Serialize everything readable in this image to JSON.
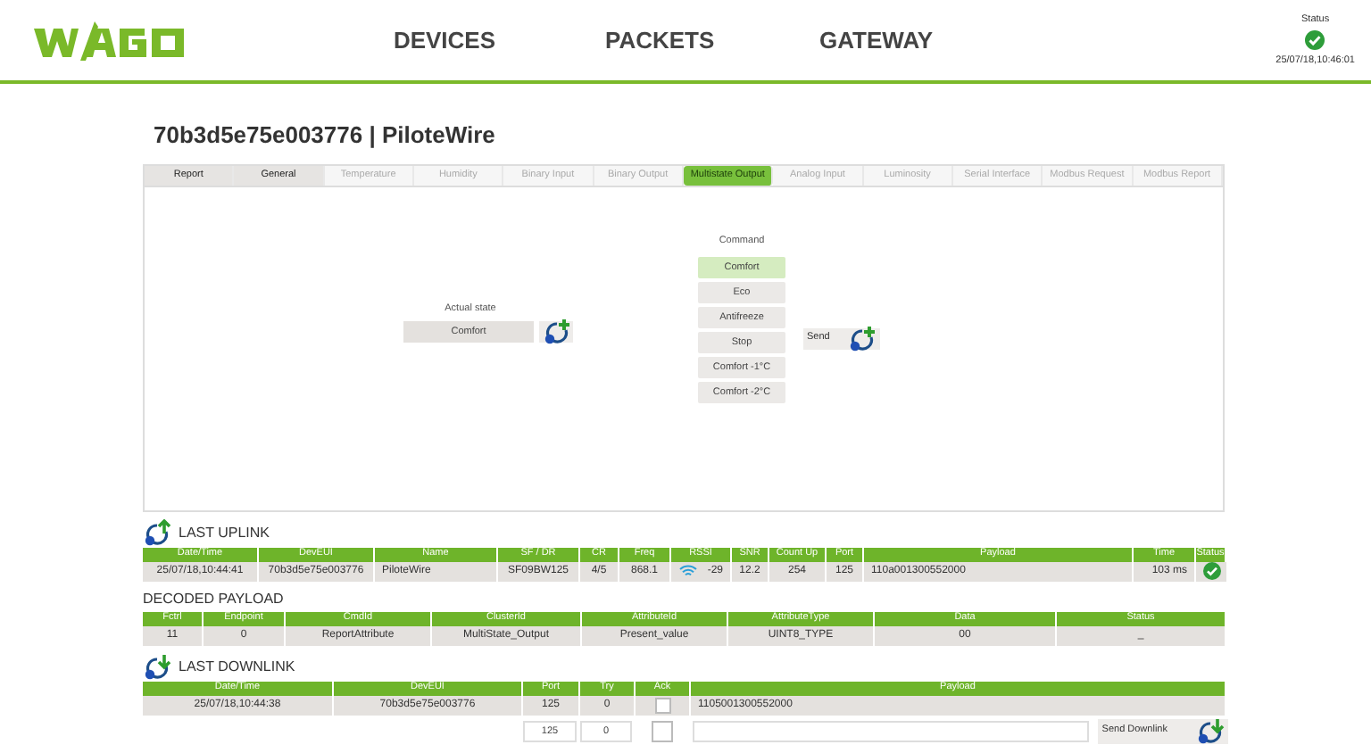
{
  "header": {
    "nav": [
      {
        "label": "DEVICES"
      },
      {
        "label": "PACKETS"
      },
      {
        "label": "GATEWAY"
      }
    ],
    "status": {
      "label": "Status",
      "ok": true,
      "time": "25/07/18,10:46:01"
    }
  },
  "title": "70b3d5e75e003776 | PiloteWire",
  "tabs": [
    {
      "label": "Report",
      "selected": false,
      "disabled": false
    },
    {
      "label": "General",
      "selected": false,
      "disabled": false
    },
    {
      "label": "Temperature",
      "selected": false,
      "disabled": true
    },
    {
      "label": "Humidity",
      "selected": false,
      "disabled": true
    },
    {
      "label": "Binary Input",
      "selected": false,
      "disabled": true
    },
    {
      "label": "Binary Output",
      "selected": false,
      "disabled": true
    },
    {
      "label": "Multistate Output",
      "selected": true,
      "disabled": false
    },
    {
      "label": "Analog Input",
      "selected": false,
      "disabled": true
    },
    {
      "label": "Luminosity",
      "selected": false,
      "disabled": true
    },
    {
      "label": "Serial Interface",
      "selected": false,
      "disabled": true
    },
    {
      "label": "Modbus Request",
      "selected": false,
      "disabled": true
    },
    {
      "label": "Modbus Report",
      "selected": false,
      "disabled": true
    }
  ],
  "actual_state": {
    "label": "Actual state",
    "value": "Comfort"
  },
  "command": {
    "label": "Command",
    "options": [
      {
        "label": "Comfort",
        "selected": true
      },
      {
        "label": "Eco",
        "selected": false
      },
      {
        "label": "Antifreeze",
        "selected": false
      },
      {
        "label": "Stop",
        "selected": false
      },
      {
        "label": "Comfort -1°C",
        "selected": false
      },
      {
        "label": "Comfort -2°C",
        "selected": false
      }
    ],
    "send": "Send"
  },
  "last_uplink": {
    "title": "LAST UPLINK",
    "columns": [
      "Date/Time",
      "DevEUI",
      "Name",
      "SF / DR",
      "CR",
      "Freq",
      "RSSI",
      "SNR",
      "Count Up",
      "Port",
      "Payload",
      "Time",
      "Status"
    ],
    "rows": [
      {
        "date": "25/07/18,10:44:41",
        "deveui": "70b3d5e75e003776",
        "name": "PiloteWire",
        "sf": "SF09BW125",
        "cr": "4/5",
        "freq": "868.1",
        "rssi": "-29",
        "snr": "12.2",
        "count_up": "254",
        "port": "125",
        "payload": "110a001300552000",
        "time": "103 ms",
        "status_ok": true
      }
    ]
  },
  "decoded_payload": {
    "title": "DECODED PAYLOAD",
    "columns": [
      "Fctrl",
      "Endpoint",
      "CmdId",
      "ClusterId",
      "AttributeId",
      "AttributeType",
      "Data",
      "Status"
    ],
    "rows": [
      [
        "11",
        "0",
        "ReportAttribute",
        "MultiState_Output",
        "Present_value",
        "UINT8_TYPE",
        "00",
        "_"
      ]
    ]
  },
  "last_downlink": {
    "title": "LAST DOWNLINK",
    "columns": [
      "Date/Time",
      "DevEUI",
      "Port",
      "Try",
      "Ack",
      "Payload"
    ],
    "rows": [
      {
        "date": "25/07/18,10:44:38",
        "deveui": "70b3d5e75e003776",
        "port": "125",
        "try": "0",
        "ack": false,
        "payload": "1105001300552000"
      }
    ],
    "form": {
      "port": "125",
      "try": "0",
      "ack": false,
      "send": "Send Downlink"
    }
  }
}
